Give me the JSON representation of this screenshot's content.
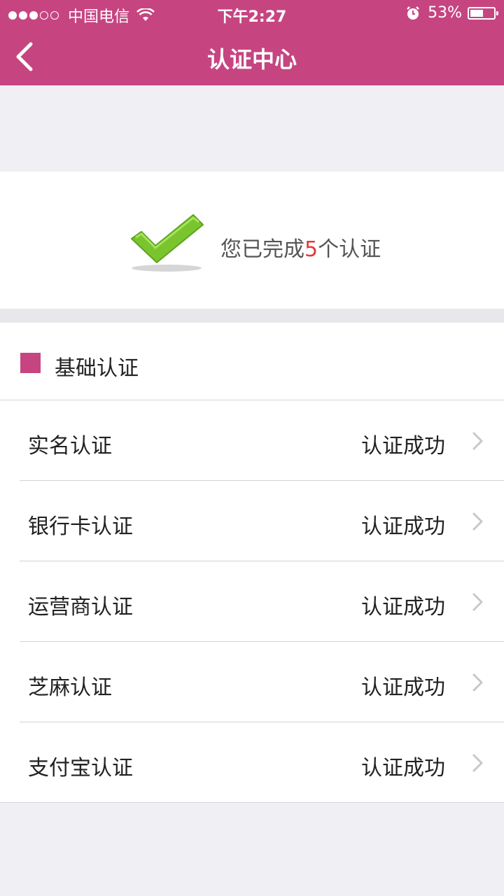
{
  "status_bar": {
    "carrier": "中国电信",
    "time": "下午2:27",
    "battery": "53%"
  },
  "nav": {
    "title": "认证中心"
  },
  "summary": {
    "prefix": "您已完成",
    "count": "5",
    "suffix": "个认证"
  },
  "section": {
    "title": "基础认证"
  },
  "items": [
    {
      "label": "实名认证",
      "status": "认证成功"
    },
    {
      "label": "银行卡认证",
      "status": "认证成功"
    },
    {
      "label": "运营商认证",
      "status": "认证成功"
    },
    {
      "label": "芝麻认证",
      "status": "认证成功"
    },
    {
      "label": "支付宝认证",
      "status": "认证成功"
    }
  ],
  "colors": {
    "brand": "#c64581",
    "highlight": "#e03a3a",
    "check_green": "#7ac52e"
  }
}
